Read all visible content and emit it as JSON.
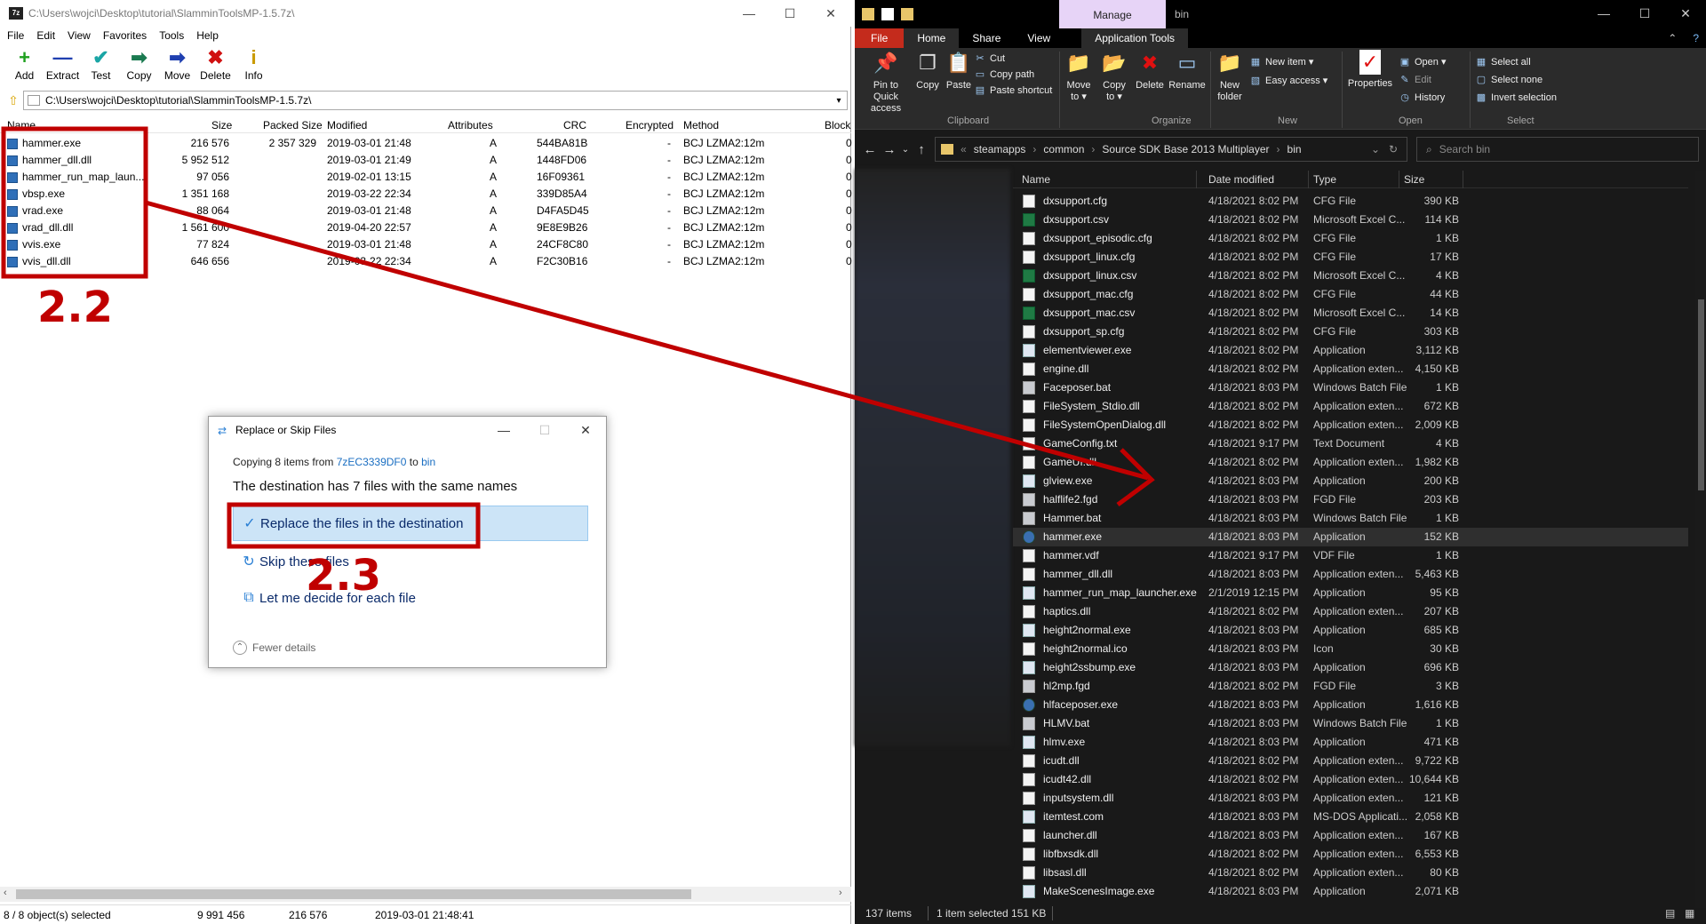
{
  "zip": {
    "title": "C:\\Users\\wojci\\Desktop\\tutorial\\SlamminToolsMP-1.5.7z\\",
    "app_icon": "7z",
    "window_buttons": [
      "—",
      "☐",
      "✕"
    ],
    "menu": [
      "File",
      "Edit",
      "View",
      "Favorites",
      "Tools",
      "Help"
    ],
    "toolbar": [
      {
        "label": "Add",
        "icon": "+",
        "color": "#1ea01e"
      },
      {
        "label": "Extract",
        "icon": "—",
        "color": "#1f3fb0"
      },
      {
        "label": "Test",
        "icon": "✔",
        "color": "#1aa5a5"
      },
      {
        "label": "Copy",
        "icon": "➡",
        "color": "#1a7a50"
      },
      {
        "label": "Move",
        "icon": "➡",
        "color": "#1f3fb0"
      },
      {
        "label": "Delete",
        "icon": "✖",
        "color": "#d01010"
      },
      {
        "label": "Info",
        "icon": "i",
        "color": "#c99a00"
      }
    ],
    "address": "C:\\Users\\wojci\\Desktop\\tutorial\\SlamminToolsMP-1.5.7z\\",
    "columns": [
      "Name",
      "Size",
      "Packed Size",
      "Modified",
      "Attributes",
      "CRC",
      "Encrypted",
      "Method",
      "Block"
    ],
    "rows": [
      {
        "name": "hammer.exe",
        "size": "216 576",
        "packed": "2 357 329",
        "modified": "2019-03-01 21:48",
        "attr": "A",
        "crc": "544BA81B",
        "enc": "-",
        "method": "BCJ LZMA2:12m",
        "block": "0"
      },
      {
        "name": "hammer_dll.dll",
        "size": "5 952 512",
        "packed": "",
        "modified": "2019-03-01 21:49",
        "attr": "A",
        "crc": "1448FD06",
        "enc": "-",
        "method": "BCJ LZMA2:12m",
        "block": "0"
      },
      {
        "name": "hammer_run_map_laun...",
        "size": "97 056",
        "packed": "",
        "modified": "2019-02-01 13:15",
        "attr": "A",
        "crc": "16F09361",
        "enc": "-",
        "method": "BCJ LZMA2:12m",
        "block": "0"
      },
      {
        "name": "vbsp.exe",
        "size": "1 351 168",
        "packed": "",
        "modified": "2019-03-22 22:34",
        "attr": "A",
        "crc": "339D85A4",
        "enc": "-",
        "method": "BCJ LZMA2:12m",
        "block": "0"
      },
      {
        "name": "vrad.exe",
        "size": "88 064",
        "packed": "",
        "modified": "2019-03-01 21:48",
        "attr": "A",
        "crc": "D4FA5D45",
        "enc": "-",
        "method": "BCJ LZMA2:12m",
        "block": "0"
      },
      {
        "name": "vrad_dll.dll",
        "size": "1 561 600",
        "packed": "",
        "modified": "2019-04-20 22:57",
        "attr": "A",
        "crc": "9E8E9B26",
        "enc": "-",
        "method": "BCJ LZMA2:12m",
        "block": "0"
      },
      {
        "name": "vvis.exe",
        "size": "77 824",
        "packed": "",
        "modified": "2019-03-01 21:48",
        "attr": "A",
        "crc": "24CF8C80",
        "enc": "-",
        "method": "BCJ LZMA2:12m",
        "block": "0"
      },
      {
        "name": "vvis_dll.dll",
        "size": "646 656",
        "packed": "",
        "modified": "2019-03-22 22:34",
        "attr": "A",
        "crc": "F2C30B16",
        "enc": "-",
        "method": "BCJ LZMA2:12m",
        "block": "0"
      }
    ],
    "status": {
      "selected": "8 / 8 object(s) selected",
      "total_size": "9 991 456",
      "sel_size": "216 576",
      "date": "2019-03-01 21:48:41"
    }
  },
  "dialog": {
    "title": "Replace or Skip Files",
    "buttons": [
      "—",
      "☐",
      "✕"
    ],
    "copying_prefix": "Copying 8 items from ",
    "source": "7zEC3339DF0",
    "to": " to ",
    "dest_link": "bin",
    "headline": "The destination has 7 files with the same names",
    "options": [
      {
        "label": "Replace the files in the destination",
        "icon": "✓"
      },
      {
        "label": "Skip these files",
        "icon": "↻"
      },
      {
        "label": "Let me decide for each file",
        "icon": "⧉"
      }
    ],
    "fewer": "Fewer details",
    "fewer_icon": "⌃"
  },
  "explorer": {
    "manage_tab": "Manage",
    "title": "bin",
    "window_buttons": [
      "—",
      "☐",
      "✕"
    ],
    "tabs": [
      "File",
      "Home",
      "Share",
      "View",
      "Application Tools"
    ],
    "tab_right": "⌃",
    "help_icon": "?",
    "ribbon": {
      "pin": "Pin to Quick\naccess",
      "pin_l1": "Pin to Quick",
      "pin_l2": "access",
      "copy": "Copy",
      "paste": "Paste",
      "cut": "Cut",
      "copy_path": "Copy path",
      "paste_shortcut": "Paste shortcut",
      "move_to_l1": "Move",
      "move_to_l2": "to ▾",
      "copy_to_l1": "Copy",
      "copy_to_l2": "to ▾",
      "delete": "Delete",
      "rename": "Rename",
      "new_folder_l1": "New",
      "new_folder_l2": "folder",
      "new_item": "New item ▾",
      "easy_access": "Easy access ▾",
      "properties": "Properties",
      "open": "Open ▾",
      "edit": "Edit",
      "history": "History",
      "select_all": "Select all",
      "select_none": "Select none",
      "invert_selection": "Invert selection",
      "groups": [
        "Clipboard",
        "Organize",
        "New",
        "Open",
        "Select"
      ]
    },
    "path": [
      "steamapps",
      "common",
      "Source SDK Base 2013 Multiplayer",
      "bin"
    ],
    "path_prefix": "«",
    "search_placeholder": "Search bin",
    "columns": [
      "Name",
      "Date modified",
      "Type",
      "Size"
    ],
    "files": [
      {
        "name": "dxsupport.cfg",
        "date": "4/18/2021 8:02 PM",
        "type": "CFG File",
        "size": "390 KB",
        "icon": "doc"
      },
      {
        "name": "dxsupport.csv",
        "date": "4/18/2021 8:02 PM",
        "type": "Microsoft Excel C...",
        "size": "114 KB",
        "icon": "xl"
      },
      {
        "name": "dxsupport_episodic.cfg",
        "date": "4/18/2021 8:02 PM",
        "type": "CFG File",
        "size": "1 KB",
        "icon": "doc"
      },
      {
        "name": "dxsupport_linux.cfg",
        "date": "4/18/2021 8:02 PM",
        "type": "CFG File",
        "size": "17 KB",
        "icon": "doc"
      },
      {
        "name": "dxsupport_linux.csv",
        "date": "4/18/2021 8:02 PM",
        "type": "Microsoft Excel C...",
        "size": "4 KB",
        "icon": "xl"
      },
      {
        "name": "dxsupport_mac.cfg",
        "date": "4/18/2021 8:02 PM",
        "type": "CFG File",
        "size": "44 KB",
        "icon": "doc"
      },
      {
        "name": "dxsupport_mac.csv",
        "date": "4/18/2021 8:02 PM",
        "type": "Microsoft Excel C...",
        "size": "14 KB",
        "icon": "xl"
      },
      {
        "name": "dxsupport_sp.cfg",
        "date": "4/18/2021 8:02 PM",
        "type": "CFG File",
        "size": "303 KB",
        "icon": "doc"
      },
      {
        "name": "elementviewer.exe",
        "date": "4/18/2021 8:02 PM",
        "type": "Application",
        "size": "3,112 KB",
        "icon": "app"
      },
      {
        "name": "engine.dll",
        "date": "4/18/2021 8:02 PM",
        "type": "Application exten...",
        "size": "4,150 KB",
        "icon": "doc"
      },
      {
        "name": "Faceposer.bat",
        "date": "4/18/2021 8:03 PM",
        "type": "Windows Batch File",
        "size": "1 KB",
        "icon": "bat"
      },
      {
        "name": "FileSystem_Stdio.dll",
        "date": "4/18/2021 8:02 PM",
        "type": "Application exten...",
        "size": "672 KB",
        "icon": "doc"
      },
      {
        "name": "FileSystemOpenDialog.dll",
        "date": "4/18/2021 8:02 PM",
        "type": "Application exten...",
        "size": "2,009 KB",
        "icon": "doc"
      },
      {
        "name": "GameConfig.txt",
        "date": "4/18/2021 9:17 PM",
        "type": "Text Document",
        "size": "4 KB",
        "icon": "doc"
      },
      {
        "name": "GameUI.dll",
        "date": "4/18/2021 8:02 PM",
        "type": "Application exten...",
        "size": "1,982 KB",
        "icon": "doc"
      },
      {
        "name": "glview.exe",
        "date": "4/18/2021 8:03 PM",
        "type": "Application",
        "size": "200 KB",
        "icon": "app"
      },
      {
        "name": "halflife2.fgd",
        "date": "4/18/2021 8:03 PM",
        "type": "FGD File",
        "size": "203 KB",
        "icon": "bat"
      },
      {
        "name": "Hammer.bat",
        "date": "4/18/2021 8:03 PM",
        "type": "Windows Batch File",
        "size": "1 KB",
        "icon": "bat"
      },
      {
        "name": "hammer.exe",
        "date": "4/18/2021 8:03 PM",
        "type": "Application",
        "size": "152 KB",
        "icon": "ham",
        "highlight": true
      },
      {
        "name": "hammer.vdf",
        "date": "4/18/2021 9:17 PM",
        "type": "VDF File",
        "size": "1 KB",
        "icon": "doc"
      },
      {
        "name": "hammer_dll.dll",
        "date": "4/18/2021 8:03 PM",
        "type": "Application exten...",
        "size": "5,463 KB",
        "icon": "doc"
      },
      {
        "name": "hammer_run_map_launcher.exe",
        "date": "2/1/2019 12:15 PM",
        "type": "Application",
        "size": "95 KB",
        "icon": "app"
      },
      {
        "name": "haptics.dll",
        "date": "4/18/2021 8:02 PM",
        "type": "Application exten...",
        "size": "207 KB",
        "icon": "doc"
      },
      {
        "name": "height2normal.exe",
        "date": "4/18/2021 8:03 PM",
        "type": "Application",
        "size": "685 KB",
        "icon": "app"
      },
      {
        "name": "height2normal.ico",
        "date": "4/18/2021 8:03 PM",
        "type": "Icon",
        "size": "30 KB",
        "icon": "doc"
      },
      {
        "name": "height2ssbump.exe",
        "date": "4/18/2021 8:03 PM",
        "type": "Application",
        "size": "696 KB",
        "icon": "app"
      },
      {
        "name": "hl2mp.fgd",
        "date": "4/18/2021 8:02 PM",
        "type": "FGD File",
        "size": "3 KB",
        "icon": "bat"
      },
      {
        "name": "hlfaceposer.exe",
        "date": "4/18/2021 8:03 PM",
        "type": "Application",
        "size": "1,616 KB",
        "icon": "ham"
      },
      {
        "name": "HLMV.bat",
        "date": "4/18/2021 8:03 PM",
        "type": "Windows Batch File",
        "size": "1 KB",
        "icon": "bat"
      },
      {
        "name": "hlmv.exe",
        "date": "4/18/2021 8:03 PM",
        "type": "Application",
        "size": "471 KB",
        "icon": "app"
      },
      {
        "name": "icudt.dll",
        "date": "4/18/2021 8:02 PM",
        "type": "Application exten...",
        "size": "9,722 KB",
        "icon": "doc"
      },
      {
        "name": "icudt42.dll",
        "date": "4/18/2021 8:02 PM",
        "type": "Application exten...",
        "size": "10,644 KB",
        "icon": "doc"
      },
      {
        "name": "inputsystem.dll",
        "date": "4/18/2021 8:03 PM",
        "type": "Application exten...",
        "size": "121 KB",
        "icon": "doc"
      },
      {
        "name": "itemtest.com",
        "date": "4/18/2021 8:03 PM",
        "type": "MS-DOS Applicati...",
        "size": "2,058 KB",
        "icon": "app"
      },
      {
        "name": "launcher.dll",
        "date": "4/18/2021 8:03 PM",
        "type": "Application exten...",
        "size": "167 KB",
        "icon": "doc"
      },
      {
        "name": "libfbxsdk.dll",
        "date": "4/18/2021 8:02 PM",
        "type": "Application exten...",
        "size": "6,553 KB",
        "icon": "doc"
      },
      {
        "name": "libsasl.dll",
        "date": "4/18/2021 8:02 PM",
        "type": "Application exten...",
        "size": "80 KB",
        "icon": "doc"
      },
      {
        "name": "MakeScenesImage.exe",
        "date": "4/18/2021 8:03 PM",
        "type": "Application",
        "size": "2,071 KB",
        "icon": "app"
      }
    ],
    "status": {
      "count": "137 items",
      "selected": "1 item selected  151 KB"
    }
  },
  "annotations": {
    "label_1": "2.2",
    "label_2": "2.3",
    "color": "#c00000"
  }
}
